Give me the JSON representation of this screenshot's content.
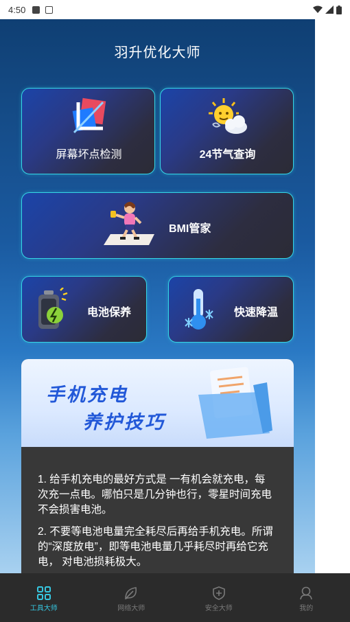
{
  "status_bar": {
    "time": "4:50"
  },
  "app": {
    "title": "羽升优化大师"
  },
  "cards": [
    {
      "label": "屏幕坏点检测",
      "icon": "screen-test-icon"
    },
    {
      "label": "24节气查询",
      "icon": "sun-cloud-icon"
    },
    {
      "label": "BMI管家",
      "icon": "fitness-girl-icon"
    },
    {
      "label": "电池保养",
      "icon": "battery-icon"
    },
    {
      "label": "快速降温",
      "icon": "thermometer-icon"
    }
  ],
  "tips": {
    "banner_line1": "手机充电",
    "banner_line2": "养护技巧",
    "items": [
      "1. 给手机充电的最好方式是 一有机会就充电，每次充一点电。哪怕只是几分钟也行，零星时间充电不会损害电池。",
      "2. 不要等电池电量完全耗尽后再给手机充电。所谓的“深度放电”，即等电池电量几乎耗尽时再给它充电， 对电池损耗极大。"
    ]
  },
  "tabs": [
    {
      "label": "工具大师",
      "active": true,
      "icon": "grid-icon"
    },
    {
      "label": "网络大师",
      "active": false,
      "icon": "leaf-icon"
    },
    {
      "label": "安全大师",
      "active": false,
      "icon": "shield-icon"
    },
    {
      "label": "我的",
      "active": false,
      "icon": "user-icon"
    }
  ],
  "colors": {
    "accent": "#36c7e0",
    "card_border": "#35d8e6",
    "banner_text": "#2258d8"
  }
}
